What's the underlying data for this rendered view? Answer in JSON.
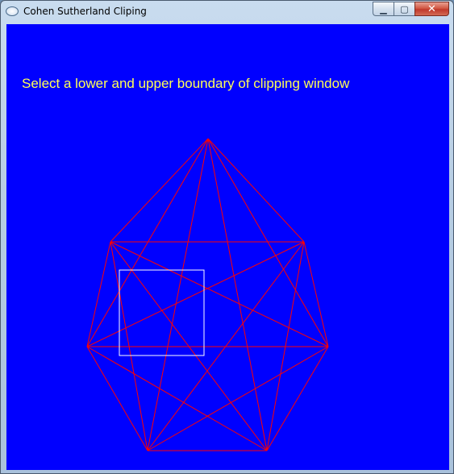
{
  "window": {
    "title": "Cohen Sutherland Cliping",
    "controls": {
      "minimize_glyph": "▁",
      "maximize_glyph": "▢",
      "close_glyph": "✕"
    }
  },
  "canvas": {
    "prompt": "Select a lower and upper boundary of clipping window",
    "colors": {
      "background": "#0000ff",
      "prompt_text": "#ffff55",
      "polygon_lines": "#ff0000",
      "clip_rect": "#ffffff"
    },
    "figure": {
      "type": "complete-graph",
      "vertex_count": 7
    }
  }
}
